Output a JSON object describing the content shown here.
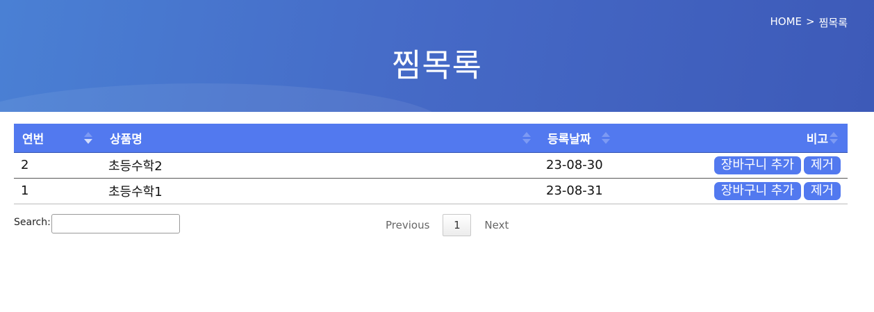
{
  "header": {
    "breadcrumb_home": "HOME",
    "breadcrumb_sep": ">",
    "breadcrumb_current": "찜목록",
    "title": "찜목록"
  },
  "table": {
    "columns": [
      "연번",
      "상품명",
      "등록날짜",
      "비고"
    ],
    "rows": [
      {
        "no": "2",
        "name": "초등수학2",
        "date": "23-08-30",
        "cart_label": "장바구니 추가",
        "remove_label": "제거"
      },
      {
        "no": "1",
        "name": "초등수학1",
        "date": "23-08-31",
        "cart_label": "장바구니 추가",
        "remove_label": "제거"
      }
    ]
  },
  "search": {
    "label": "Search:",
    "value": ""
  },
  "pagination": {
    "previous_label": "Previous",
    "current_page": "1",
    "next_label": "Next"
  },
  "colors": {
    "header_gradient_start": "#4a80d4",
    "header_gradient_end": "#3d5ab8",
    "accent": "#5279ef"
  }
}
